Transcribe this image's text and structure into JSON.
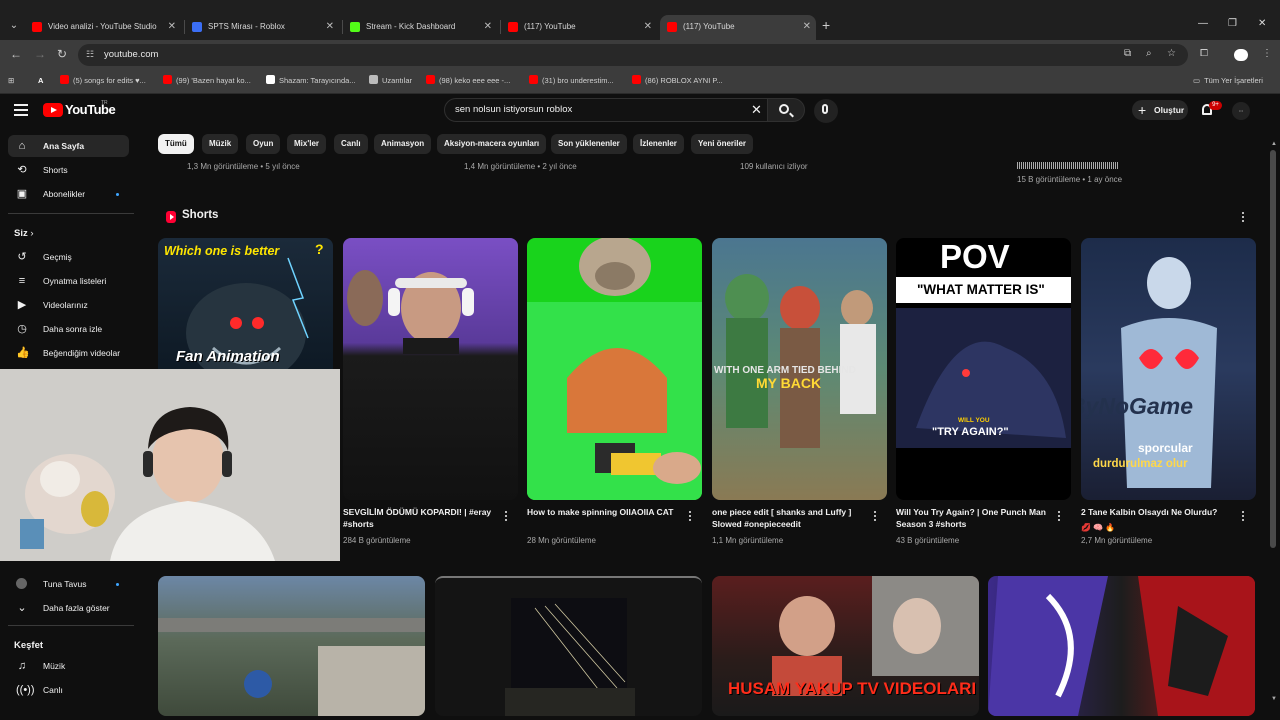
{
  "browser": {
    "tabs": [
      {
        "label": "Video analizi - YouTube Studio",
        "color": "#ff0000"
      },
      {
        "label": "SPTS Mirası - Roblox",
        "color": "#3b6ef5"
      },
      {
        "label": "Stream - Kick Dashboard",
        "color": "#53fc18"
      },
      {
        "label": "(117) YouTube",
        "color": "#ff0000"
      },
      {
        "label": "(117) YouTube",
        "color": "#ff0000"
      }
    ],
    "url": "youtube.com",
    "bookmarks": [
      {
        "label": "A",
        "color": "#1a73e8"
      },
      {
        "label": "(5) songs for edits ♥...",
        "color": "#ff0000"
      },
      {
        "label": "(99) 'Bazen hayat ko...",
        "color": "#ff0000"
      },
      {
        "label": "Shazam: Tarayıcında...",
        "color": "#ffffff"
      },
      {
        "label": "Uzantılar",
        "color": "#bbbbbb"
      },
      {
        "label": "(98) keko eee eee -...",
        "color": "#ff0000"
      },
      {
        "label": "(31) bro underestim...",
        "color": "#ff0000"
      },
      {
        "label": "(86) ROBLOX AYNI P...",
        "color": "#ff0000"
      }
    ],
    "all_bookmarks": "Tüm Yer İşaretleri"
  },
  "youtube": {
    "logo_text": "YouTube",
    "logo_region": "TR",
    "search_value": "sen nolsun istiyorsun roblox",
    "create_label": "Oluştur",
    "notif_count": "9+",
    "chips": [
      "Tümü",
      "Müzik",
      "Oyun",
      "Mix'ler",
      "Canlı",
      "Animasyon",
      "Aksiyon-macera oyunları",
      "Son yüklenenler",
      "İzlenenler",
      "Yeni öneriler"
    ],
    "sidebar": {
      "main": [
        {
          "label": "Ana Sayfa",
          "icon": "home-icon"
        },
        {
          "label": "Shorts",
          "icon": "shorts-icon"
        },
        {
          "label": "Abonelikler",
          "icon": "subscriptions-icon"
        }
      ],
      "you_heading": "Siz",
      "you": [
        {
          "label": "Geçmiş",
          "icon": "history-icon"
        },
        {
          "label": "Oynatma listeleri",
          "icon": "playlist-icon"
        },
        {
          "label": "Videolarınız",
          "icon": "your-videos-icon"
        },
        {
          "label": "Daha sonra izle",
          "icon": "watch-later-icon"
        },
        {
          "label": "Beğendiğim videolar",
          "icon": "liked-icon"
        }
      ],
      "subs": [
        {
          "label": "Tuna Tavus"
        },
        {
          "label": "Daha fazla göster"
        }
      ],
      "explore_heading": "Keşfet",
      "explore": [
        {
          "label": "Müzik",
          "icon": "music-icon"
        },
        {
          "label": "Canlı",
          "icon": "live-icon"
        }
      ]
    },
    "top_meta": [
      "1,3 Mn görüntüleme • 5 yıl önce",
      "1,4 Mn görüntüleme • 2 yıl önce",
      "109 kullanıcı izliyor",
      "15 B görüntüleme • 1 ay önce"
    ],
    "shorts_title": "Shorts",
    "shorts": [
      {
        "title": "",
        "views": "",
        "overlay_top": "Which one is better",
        "overlay_bottom": "Fan Animation"
      },
      {
        "title": "SEVGİLİM ÖDÜMÜ KOPARDI! | #eray #shorts",
        "views": "284 B görüntüleme"
      },
      {
        "title": "How to make spinning OIIAOIIA CAT",
        "views": "28 Mn görüntüleme"
      },
      {
        "title": "one piece edit [ shanks and Luffy ] Slowed #onepieceedit",
        "views": "1,1 Mn görüntüleme",
        "overlay_a": "WITH ONE ARM TIED BEHIND",
        "overlay_b": "MY BACK"
      },
      {
        "title": "Will You Try Again? | One Punch Man Season 3 #shorts",
        "views": "43 B görüntüleme",
        "overlay_pov": "POV",
        "overlay_matter": "\"WHAT MATTER IS\"",
        "overlay_will": "WILL YOU",
        "overlay_try": "\"TRY AGAIN?\""
      },
      {
        "title": "2 Tane Kalbin Olsaydı Ne Olurdu?",
        "views": "2,7 Mn görüntüleme",
        "overlay_line1": "sporcular",
        "overlay_line2": "durdurulmaz olur",
        "watermark": "ByNoGame"
      }
    ],
    "videos": [
      {
        "overlay": ""
      },
      {
        "overlay": ""
      },
      {
        "overlay": "HUSAM YAKUP TV VIDEOLARI İZLİYOR"
      },
      {
        "overlay": ""
      }
    ]
  }
}
